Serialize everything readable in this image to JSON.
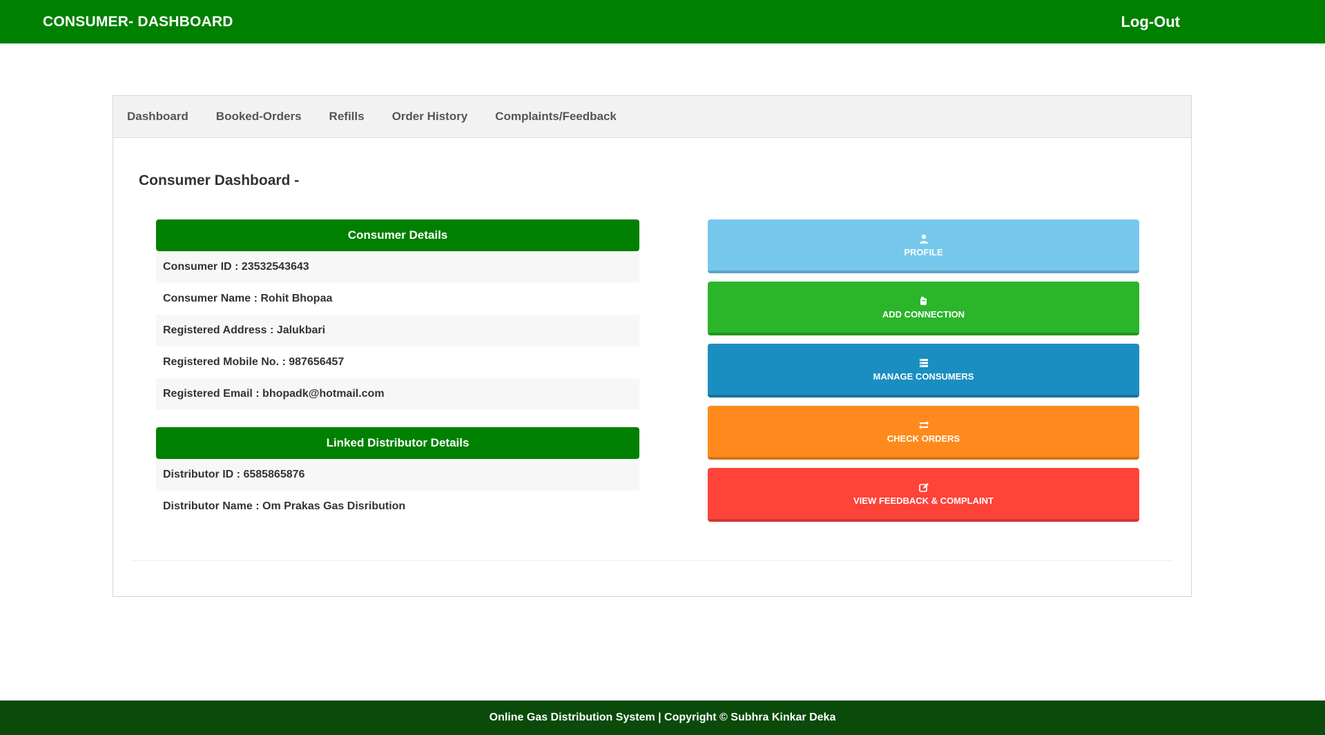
{
  "header": {
    "brand": "CONSUMER- DASHBOARD",
    "logout_label": "Log-Out"
  },
  "tabs": [
    {
      "label": "Dashboard"
    },
    {
      "label": "Booked-Orders"
    },
    {
      "label": "Refills"
    },
    {
      "label": "Order History"
    },
    {
      "label": "Complaints/Feedback"
    }
  ],
  "main": {
    "title": "Consumer Dashboard -",
    "consumer_section": {
      "header": "Consumer Details",
      "rows": [
        "Consumer ID : 23532543643",
        "Consumer Name : Rohit Bhopaa",
        "Registered Address : Jalukbari",
        "Registered Mobile No. : 987656457",
        "Registered Email : bhopadk@hotmail.com"
      ]
    },
    "distributor_section": {
      "header": "Linked Distributor Details",
      "rows": [
        "Distributor ID : 6585865876",
        "Distributor Name : Om Prakas Gas Disribution"
      ]
    },
    "actions": [
      {
        "label": "PROFILE",
        "icon": "user-icon",
        "color": "#75c8ec"
      },
      {
        "label": "ADD CONNECTION",
        "icon": "cylinder-icon",
        "color": "#2ab52a"
      },
      {
        "label": "MANAGE CONSUMERS",
        "icon": "list-icon",
        "color": "#1a8ec0"
      },
      {
        "label": "CHECK ORDERS",
        "icon": "retweet-icon",
        "color": "#fe8a1d"
      },
      {
        "label": "VIEW FEEDBACK & COMPLAINT",
        "icon": "edit-icon",
        "color": "#fe4339"
      }
    ]
  },
  "footer": {
    "text": "Online Gas Distribution System | Copyright © Subhra Kinkar Deka"
  },
  "colors": {
    "primary_green": "#008000",
    "footer_green": "#0a4a0a"
  }
}
